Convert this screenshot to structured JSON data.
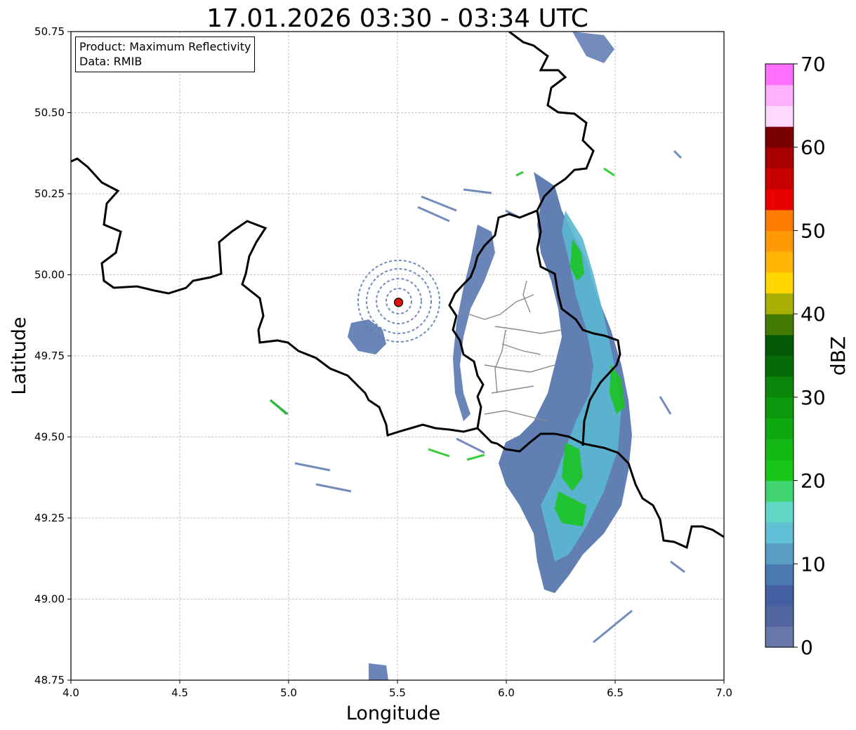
{
  "title": "17.01.2026 03:30 - 03:34 UTC",
  "info_box": {
    "line1": "Product: Maximum Reflectivity",
    "line2": "Data: RMIB"
  },
  "axes": {
    "xlabel": "Longitude",
    "ylabel": "Latitude",
    "xlim": [
      4.0,
      7.0
    ],
    "ylim": [
      48.75,
      50.75
    ],
    "xticks": [
      "4.0",
      "4.5",
      "5.0",
      "5.5",
      "6.0",
      "6.5",
      "7.0"
    ],
    "yticks": [
      "48.75",
      "49.00",
      "49.25",
      "49.50",
      "49.75",
      "50.00",
      "50.25",
      "50.50",
      "50.75"
    ],
    "grid": true
  },
  "radar_site": {
    "lon": 5.505,
    "lat": 49.915,
    "color": "#e01010"
  },
  "colorbar": {
    "label": "dBZ",
    "range": [
      0,
      70
    ],
    "step": 2.5,
    "ticks": [
      "0",
      "10",
      "20",
      "30",
      "40",
      "50",
      "60",
      "70"
    ],
    "colors": [
      "#6677a8",
      "#5466a0",
      "#4460a0",
      "#4a7ab0",
      "#5a9ec6",
      "#62c0d6",
      "#62d6c4",
      "#40d470",
      "#18c618",
      "#14b814",
      "#10a810",
      "#0c980c",
      "#0a860a",
      "#066a06",
      "#045a04",
      "#447a04",
      "#a8b004",
      "#ffd600",
      "#ffb404",
      "#ff9a04",
      "#ff7c00",
      "#e80000",
      "#c80000",
      "#a80000",
      "#780000",
      "#ffd8ff",
      "#ffb0ff",
      "#ff70ff",
      "#f040f0"
    ]
  }
}
